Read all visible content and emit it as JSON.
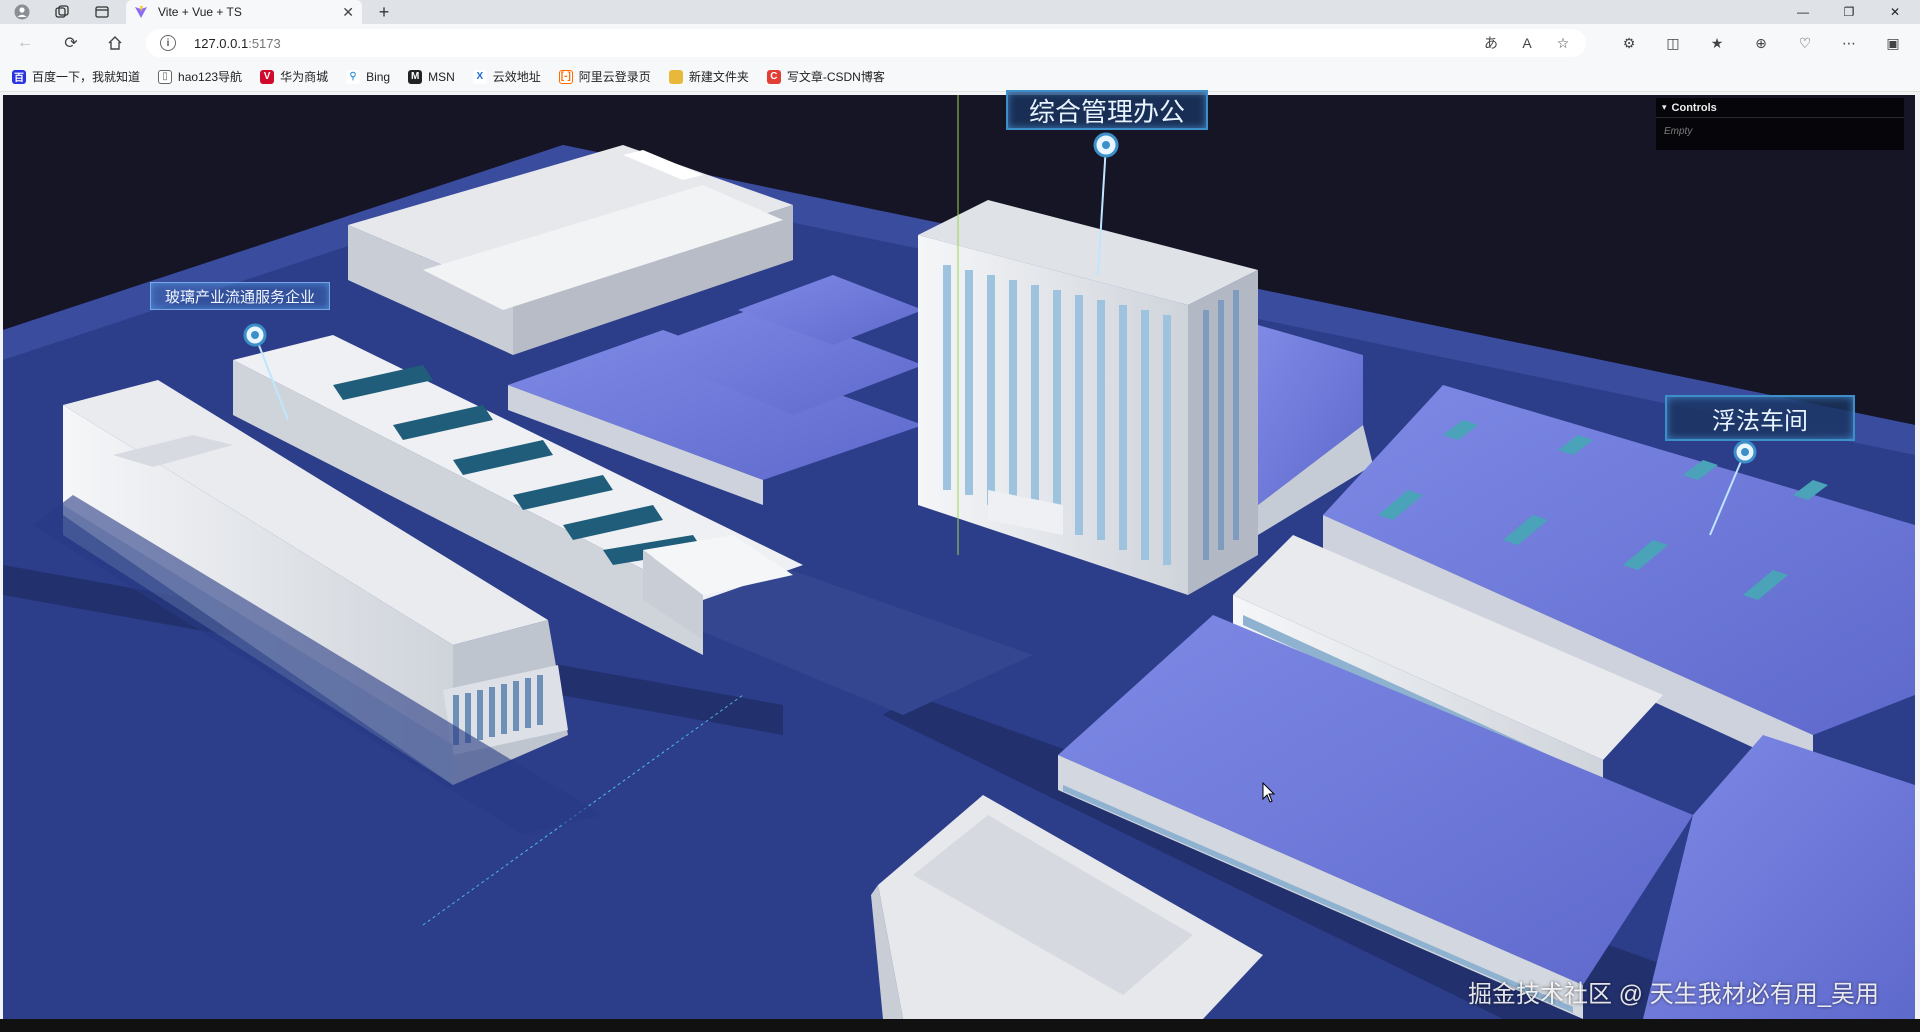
{
  "browser": {
    "tab_title": "Vite + Vue + TS",
    "url_host": "127.0.0.1",
    "url_port": ":5173",
    "bookmarks": [
      {
        "label": "百度一下，我就知道",
        "icon": "baidu-icon",
        "color": "#2932e1"
      },
      {
        "label": "hao123导航",
        "icon": "page-icon",
        "color": "#666666"
      },
      {
        "label": "华为商城",
        "icon": "huawei-icon",
        "color": "#cf0a2c"
      },
      {
        "label": "Bing",
        "icon": "search-icon",
        "color": "#0078d4"
      },
      {
        "label": "MSN",
        "icon": "msn-icon",
        "color": "#222222"
      },
      {
        "label": "云效地址",
        "icon": "yunxiao-icon",
        "color": "#1b6bd8"
      },
      {
        "label": "阿里云登录页",
        "icon": "aliyun-icon",
        "color": "#ff6a00"
      },
      {
        "label": "新建文件夹",
        "icon": "folder-icon",
        "color": "#e8b83a"
      },
      {
        "label": "写文章-CSDN博客",
        "icon": "csdn-icon",
        "color": "#e33e33"
      }
    ]
  },
  "controls": {
    "title": "Controls",
    "empty_text": "Empty"
  },
  "labels": {
    "office": "综合管理办公",
    "glass": "玻璃产业流通服务企业",
    "float": "浮法车间"
  },
  "watermark": "掘金技术社区 @ 天生我材必有用_吴用",
  "colors": {
    "ground": "#2c3d8a",
    "roof_blue": "#6d78d8",
    "building_white": "#e9ebef",
    "label_border": "#3d8fc9",
    "sky": "#161526"
  }
}
